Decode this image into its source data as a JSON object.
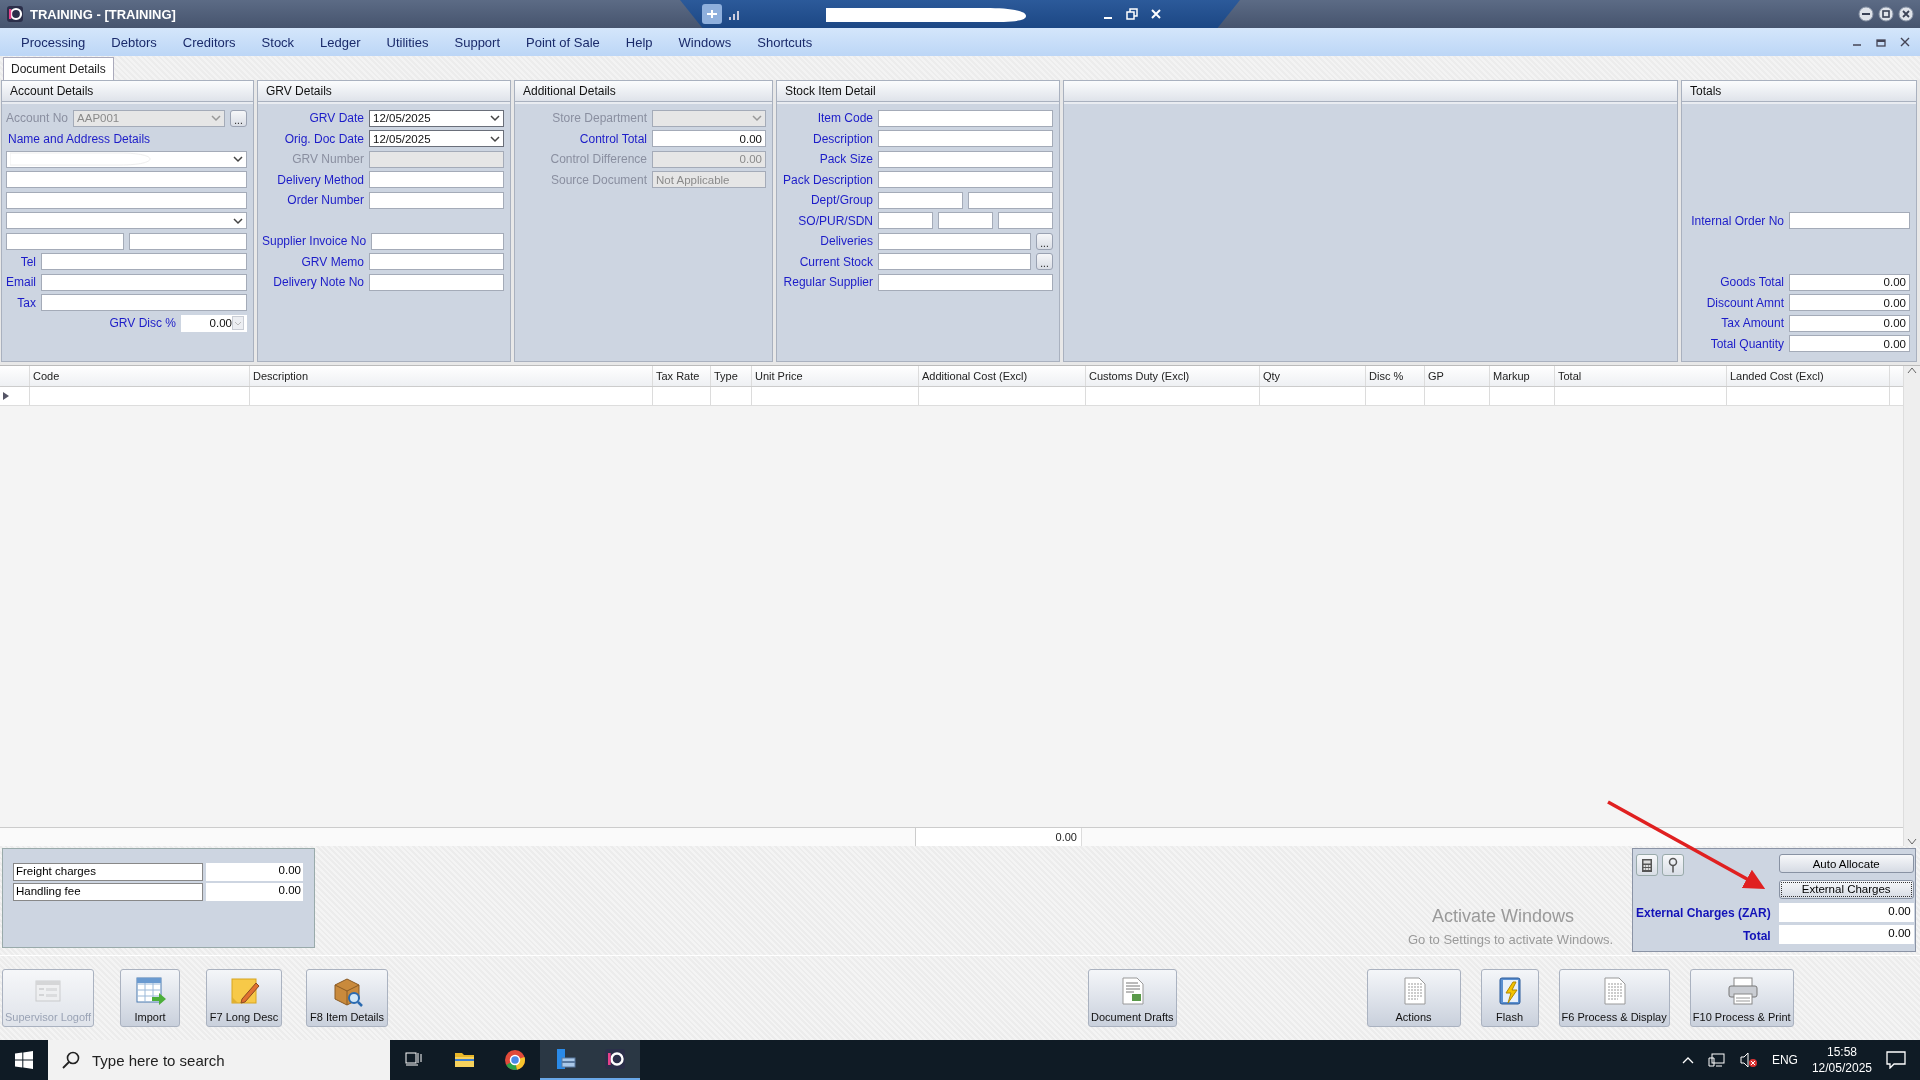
{
  "window": {
    "title": "TRAINING - [TRAINING]"
  },
  "menu": [
    "Processing",
    "Debtors",
    "Creditors",
    "Stock",
    "Ledger",
    "Utilities",
    "Support",
    "Point of Sale",
    "Help",
    "Windows",
    "Shortcuts"
  ],
  "tabs": [
    {
      "label": "Document Details",
      "selected": true
    }
  ],
  "panels": [
    {
      "kind": "form",
      "title": "Account Details",
      "rows": [
        {
          "kind": "combo",
          "label": "Account No",
          "value": "AAP001",
          "disabled": true,
          "button": "..."
        },
        {
          "kind": "heading",
          "label": "Name and Address Details"
        },
        {
          "kind": "combo",
          "redacted": true
        },
        {
          "kind": "text"
        },
        {
          "kind": "text"
        },
        {
          "kind": "dropdown"
        },
        {
          "kind": "split2"
        },
        {
          "kind": "text",
          "label": "Tel"
        },
        {
          "kind": "text",
          "label": "Email"
        },
        {
          "kind": "text",
          "label": "Tax"
        },
        {
          "kind": "disc",
          "label": "GRV Disc %",
          "value": "0.00"
        }
      ]
    },
    {
      "kind": "form",
      "title": "GRV Details",
      "rows": [
        {
          "kind": "date",
          "label": "GRV Date",
          "value": "12/05/2025"
        },
        {
          "kind": "date",
          "label": "Orig. Doc Date",
          "value": "12/05/2025"
        },
        {
          "kind": "text",
          "label": "GRV Number",
          "disabled": true
        },
        {
          "kind": "text",
          "label": "Delivery Method"
        },
        {
          "kind": "text",
          "label": "Order Number"
        },
        {
          "kind": "gap"
        },
        {
          "kind": "text",
          "label": "Supplier Invoice No"
        },
        {
          "kind": "text",
          "label": "GRV Memo"
        },
        {
          "kind": "text",
          "label": "Delivery Note No"
        }
      ]
    },
    {
      "kind": "form",
      "title": "Additional Details",
      "rows": [
        {
          "kind": "dropdown",
          "label": "Store Department",
          "disabled": true
        },
        {
          "kind": "number",
          "label": "Control Total",
          "value": "0.00"
        },
        {
          "kind": "number",
          "label": "Control Difference",
          "value": "0.00",
          "disabled": true
        },
        {
          "kind": "text",
          "label": "Source Document",
          "value": "Not Applicable",
          "disabled": true
        }
      ]
    },
    {
      "kind": "form",
      "title": "Stock Item Detail",
      "rows": [
        {
          "kind": "text",
          "label": "Item Code"
        },
        {
          "kind": "text",
          "label": "Description"
        },
        {
          "kind": "text",
          "label": "Pack Size"
        },
        {
          "kind": "text",
          "label": "Pack Description"
        },
        {
          "kind": "split2",
          "label": "Dept/Group"
        },
        {
          "kind": "split3",
          "label": "SO/PUR/SDN"
        },
        {
          "kind": "lookup",
          "label": "Deliveries",
          "button": "..."
        },
        {
          "kind": "lookup",
          "label": "Current Stock",
          "button": "..."
        },
        {
          "kind": "text",
          "label": "Regular Supplier"
        }
      ]
    },
    {
      "kind": "blank"
    },
    {
      "kind": "form",
      "title": "Totals",
      "rows": [
        {
          "kind": "gap"
        },
        {
          "kind": "gap"
        },
        {
          "kind": "gap"
        },
        {
          "kind": "gap"
        },
        {
          "kind": "gap"
        },
        {
          "kind": "text",
          "label": "Internal Order No"
        },
        {
          "kind": "gap"
        },
        {
          "kind": "gap"
        },
        {
          "kind": "number",
          "label": "Goods Total",
          "value": "0.00"
        },
        {
          "kind": "number",
          "label": "Discount Amnt",
          "value": "0.00"
        },
        {
          "kind": "number",
          "label": "Tax Amount",
          "value": "0.00"
        },
        {
          "kind": "number",
          "label": "Total Quantity",
          "value": "0.00"
        }
      ]
    }
  ],
  "table": {
    "columns": [
      "Code",
      "Description",
      "Tax Rate",
      "Type",
      "Unit Price",
      "Additional Cost (Excl)",
      "Customs Duty (Excl)",
      "Qty",
      "Disc %",
      "GP",
      "Markup",
      "Total",
      "Landed Cost (Excl)"
    ],
    "footer_total": "0.00"
  },
  "charges": [
    {
      "label": "Freight charges",
      "value": "0.00"
    },
    {
      "label": "Handling fee",
      "value": "0.00"
    }
  ],
  "allocation": {
    "buttons": [
      "Auto Allocate",
      "External Charges"
    ],
    "fields": [
      {
        "label": "External Charges (ZAR)",
        "value": "0.00"
      },
      {
        "label": "Total",
        "value": "0.00"
      }
    ]
  },
  "actions": [
    {
      "label": "Supervisor Logoff",
      "disabled": true
    },
    {
      "label": "Import",
      "disabled": false
    },
    {
      "label": "F7 Long Desc",
      "disabled": false
    },
    {
      "label": "F8 Item Details",
      "disabled": false
    },
    {
      "label": "Document Drafts",
      "disabled": false
    },
    {
      "label": "Actions",
      "disabled": false
    },
    {
      "label": "Flash",
      "disabled": false
    },
    {
      "label": "F6 Process & Display",
      "disabled": false
    },
    {
      "label": "F10 Process & Print",
      "disabled": false
    }
  ],
  "os_notice": {
    "title": "Activate Windows",
    "text": "Go to Settings to activate Windows."
  },
  "taskbar": {
    "search": {
      "placeholder": "Type here to search"
    },
    "language": "ENG",
    "time": "15:58",
    "date": "12/05/2025"
  }
}
